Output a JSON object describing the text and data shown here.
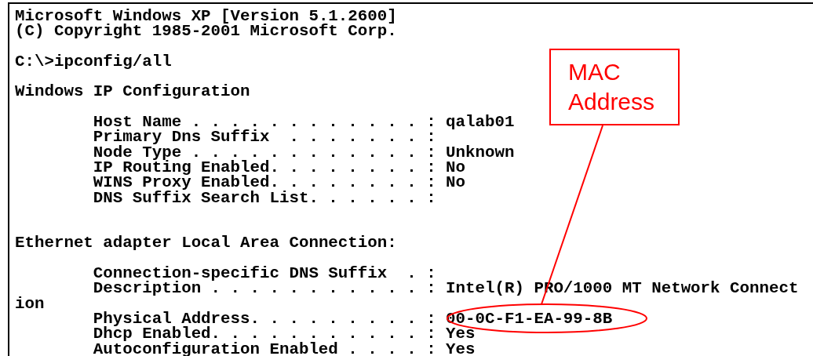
{
  "console": {
    "lines": [
      {
        "kind": "text",
        "text": "Microsoft Windows XP [Version 5.1.2600]"
      },
      {
        "kind": "text",
        "text": "(C) Copyright 1985-2001 Microsoft Corp."
      },
      {
        "kind": "blank"
      },
      {
        "kind": "text",
        "text": "C:\\>ipconfig/all"
      },
      {
        "kind": "blank"
      },
      {
        "kind": "text",
        "text": "Windows IP Configuration"
      },
      {
        "kind": "blank"
      },
      {
        "kind": "entry",
        "label": "Host Name . . . . . . . . . . . . :",
        "value": "qalab01"
      },
      {
        "kind": "entry",
        "label": "Primary Dns Suffix  . . . . . . . :"
      },
      {
        "kind": "entry",
        "label": "Node Type . . . . . . . . . . . . :",
        "value": "Unknown"
      },
      {
        "kind": "entry",
        "label": "IP Routing Enabled. . . . . . . . :",
        "value": "No"
      },
      {
        "kind": "entry",
        "label": "WINS Proxy Enabled. . . . . . . . :",
        "value": "No"
      },
      {
        "kind": "entry",
        "label": "DNS Suffix Search List. . . . . . :"
      },
      {
        "kind": "blank"
      },
      {
        "kind": "blank"
      },
      {
        "kind": "text",
        "text": "Ethernet adapter Local Area Connection:"
      },
      {
        "kind": "blank"
      },
      {
        "kind": "entry",
        "label": "Connection-specific DNS Suffix  . :"
      },
      {
        "kind": "entry",
        "label": "Description . . . . . . . . . . . :",
        "value": "Intel(R) PRO/1000 MT Network Connect"
      },
      {
        "kind": "text",
        "text": "ion"
      },
      {
        "kind": "entry",
        "label": "Physical Address. . . . . . . . . :",
        "value": "00-0C-F1-EA-99-8B"
      },
      {
        "kind": "entry",
        "label": "Dhcp Enabled. . . . . . . . . . . :",
        "value": "Yes"
      },
      {
        "kind": "entry",
        "label": "Autoconfiguration Enabled . . . . :",
        "value": "Yes"
      }
    ]
  },
  "annotation": {
    "label": "MAC Address"
  }
}
